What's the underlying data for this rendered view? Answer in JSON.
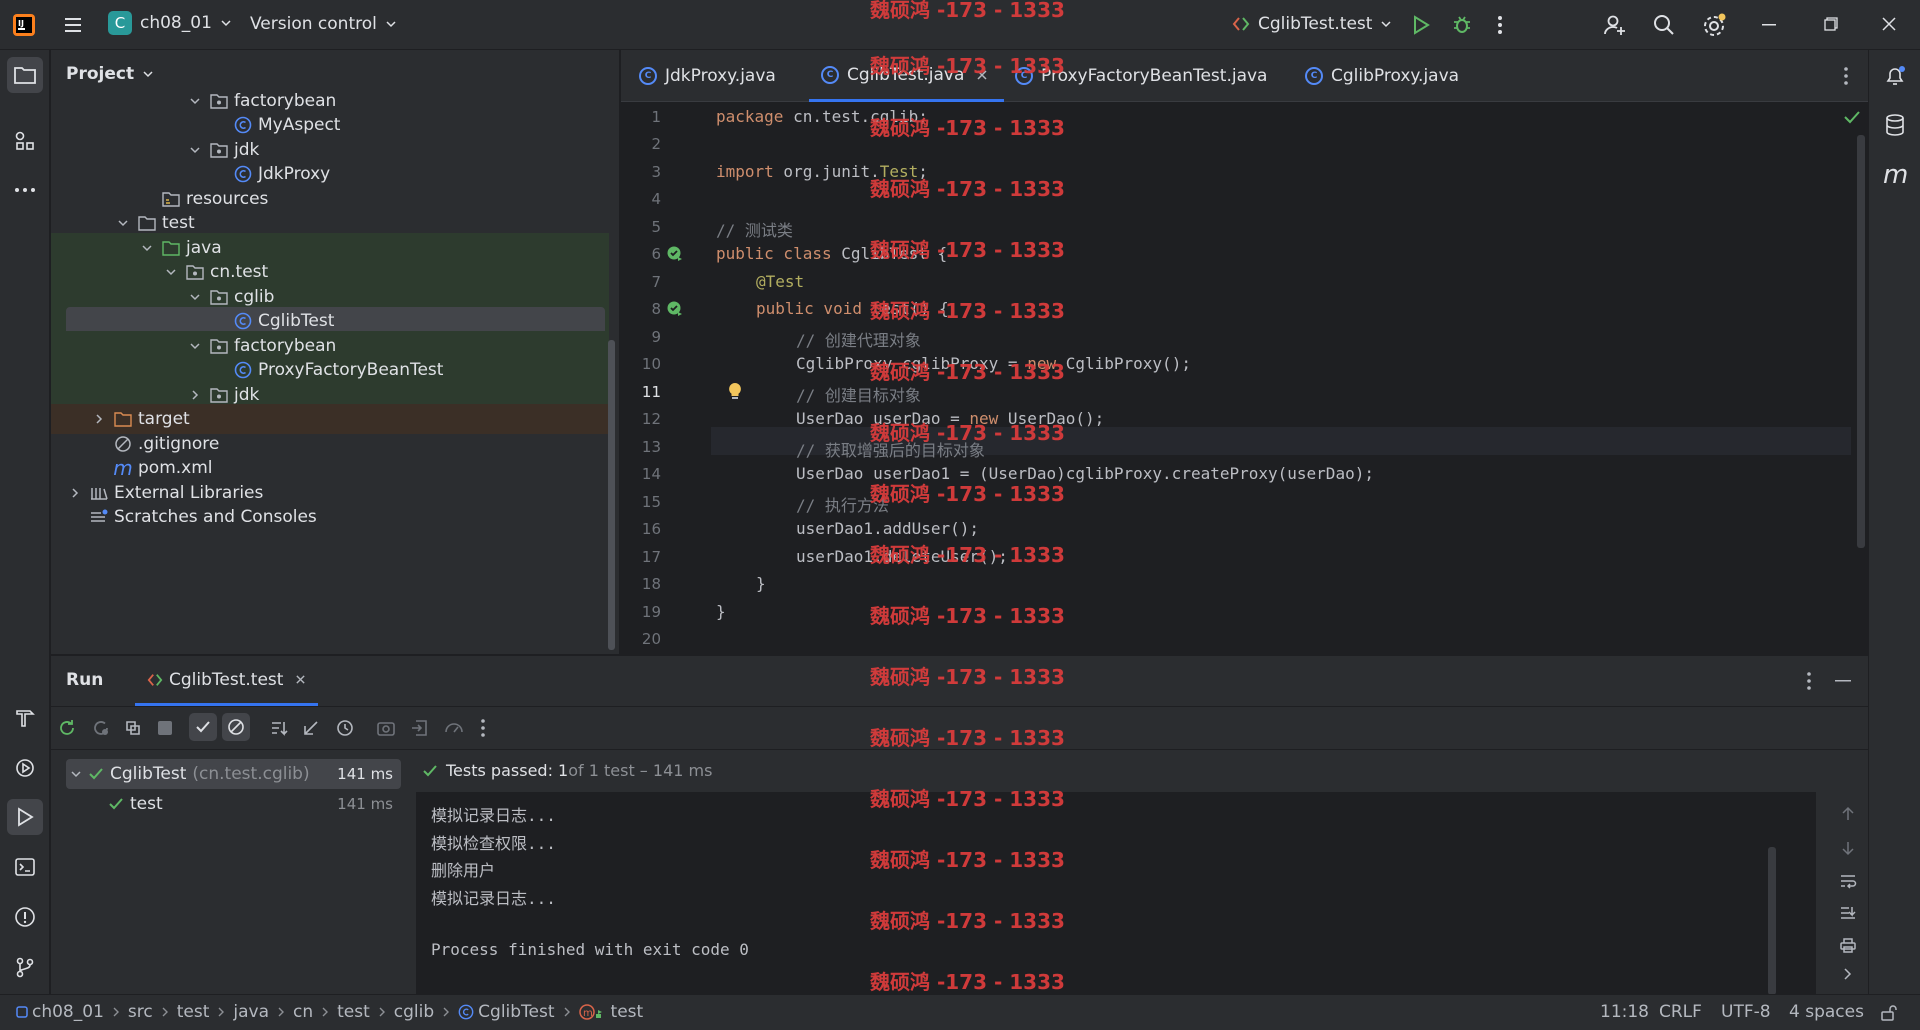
{
  "titlebar": {
    "project_name": "ch08_01",
    "project_initial": "C",
    "vcs_label": "Version control",
    "run_config": "CglibTest.test"
  },
  "project_panel": {
    "title": "Project",
    "tree": [
      {
        "label": "factorybean",
        "type": "package"
      },
      {
        "label": "MyAspect",
        "type": "class"
      },
      {
        "label": "jdk",
        "type": "package"
      },
      {
        "label": "JdkProxy",
        "type": "class"
      },
      {
        "label": "resources",
        "type": "resources"
      },
      {
        "label": "test",
        "type": "folder"
      },
      {
        "label": "java",
        "type": "test-root"
      },
      {
        "label": "cn.test",
        "type": "package"
      },
      {
        "label": "cglib",
        "type": "package"
      },
      {
        "label": "CglibTest",
        "type": "class"
      },
      {
        "label": "factorybean",
        "type": "package"
      },
      {
        "label": "ProxyFactoryBeanTest",
        "type": "class"
      },
      {
        "label": "jdk",
        "type": "package"
      },
      {
        "label": "target",
        "type": "excluded"
      },
      {
        "label": ".gitignore",
        "type": "ignore"
      },
      {
        "label": "pom.xml",
        "type": "maven"
      },
      {
        "label": "External Libraries",
        "type": "libraries"
      },
      {
        "label": "Scratches and Consoles",
        "type": "scratches"
      }
    ]
  },
  "editor": {
    "tabs": [
      "JdkProxy.java",
      "CglibTest.java",
      "ProxyFactoryBeanTest.java",
      "CglibProxy.java"
    ],
    "active_tab": "CglibTest.java",
    "line_numbers": [
      "1",
      "2",
      "3",
      "4",
      "5",
      "6",
      "7",
      "8",
      "9",
      "10",
      "11",
      "12",
      "13",
      "14",
      "15",
      "16",
      "17",
      "18",
      "19",
      "20"
    ],
    "code": {
      "l1_kw": "package",
      "l1_rest": " cn.test.cglib;",
      "l3_kw": "import",
      "l3_mid": " org.junit.",
      "l3_an": "Test",
      "l3_end": ";",
      "l5": "// 测试类",
      "l6_kw": "public class",
      "l6_rest": " CglibTest {",
      "l7": "@Test",
      "l8_kw": "public void",
      "l8_rest": " test() {",
      "l9": "// 创建代理对象",
      "l10_a": "CglibProxy cglibProxy = ",
      "l10_kw": "new",
      "l10_b": " CglibProxy();",
      "l11": "// 创建目标对象",
      "l12_a": "UserDao userDao = ",
      "l12_kw": "new",
      "l12_b": " UserDao();",
      "l13": "// 获取增强后的目标对象",
      "l14": "UserDao userDao1 = (UserDao)cglibProxy.createProxy(userDao);",
      "l15": "// 执行方法",
      "l16": "userDao1.addUser();",
      "l17": "userDao1.deleteUser();",
      "l18": "}",
      "l19": "}"
    }
  },
  "run_panel": {
    "title": "Run",
    "tab": "CglibTest.test",
    "tree": {
      "root_label": "CglibTest",
      "root_pkg": "(cn.test.cglib)",
      "root_time": "141 ms",
      "child_label": "test",
      "child_time": "141 ms"
    },
    "status": {
      "passed_label": "Tests passed: 1",
      "rest": " of 1 test – 141 ms"
    },
    "console": [
      "模拟记录日志...",
      "模拟检查权限...",
      "删除用户",
      "模拟记录日志...",
      "",
      "Process finished with exit code 0"
    ]
  },
  "statusbar": {
    "crumbs": [
      "ch08_01",
      "src",
      "test",
      "java",
      "cn",
      "test",
      "cglib",
      "CglibTest",
      "test"
    ],
    "position": "11:18",
    "line_sep": "CRLF",
    "encoding": "UTF-8",
    "indent": "4 spaces"
  },
  "watermark": "魏硕鸿 -173 - 1333",
  "colors": {
    "accent": "#3574f0",
    "class_icon": "#548af7",
    "success": "#5fb865",
    "watermark": "#d93c3c"
  }
}
